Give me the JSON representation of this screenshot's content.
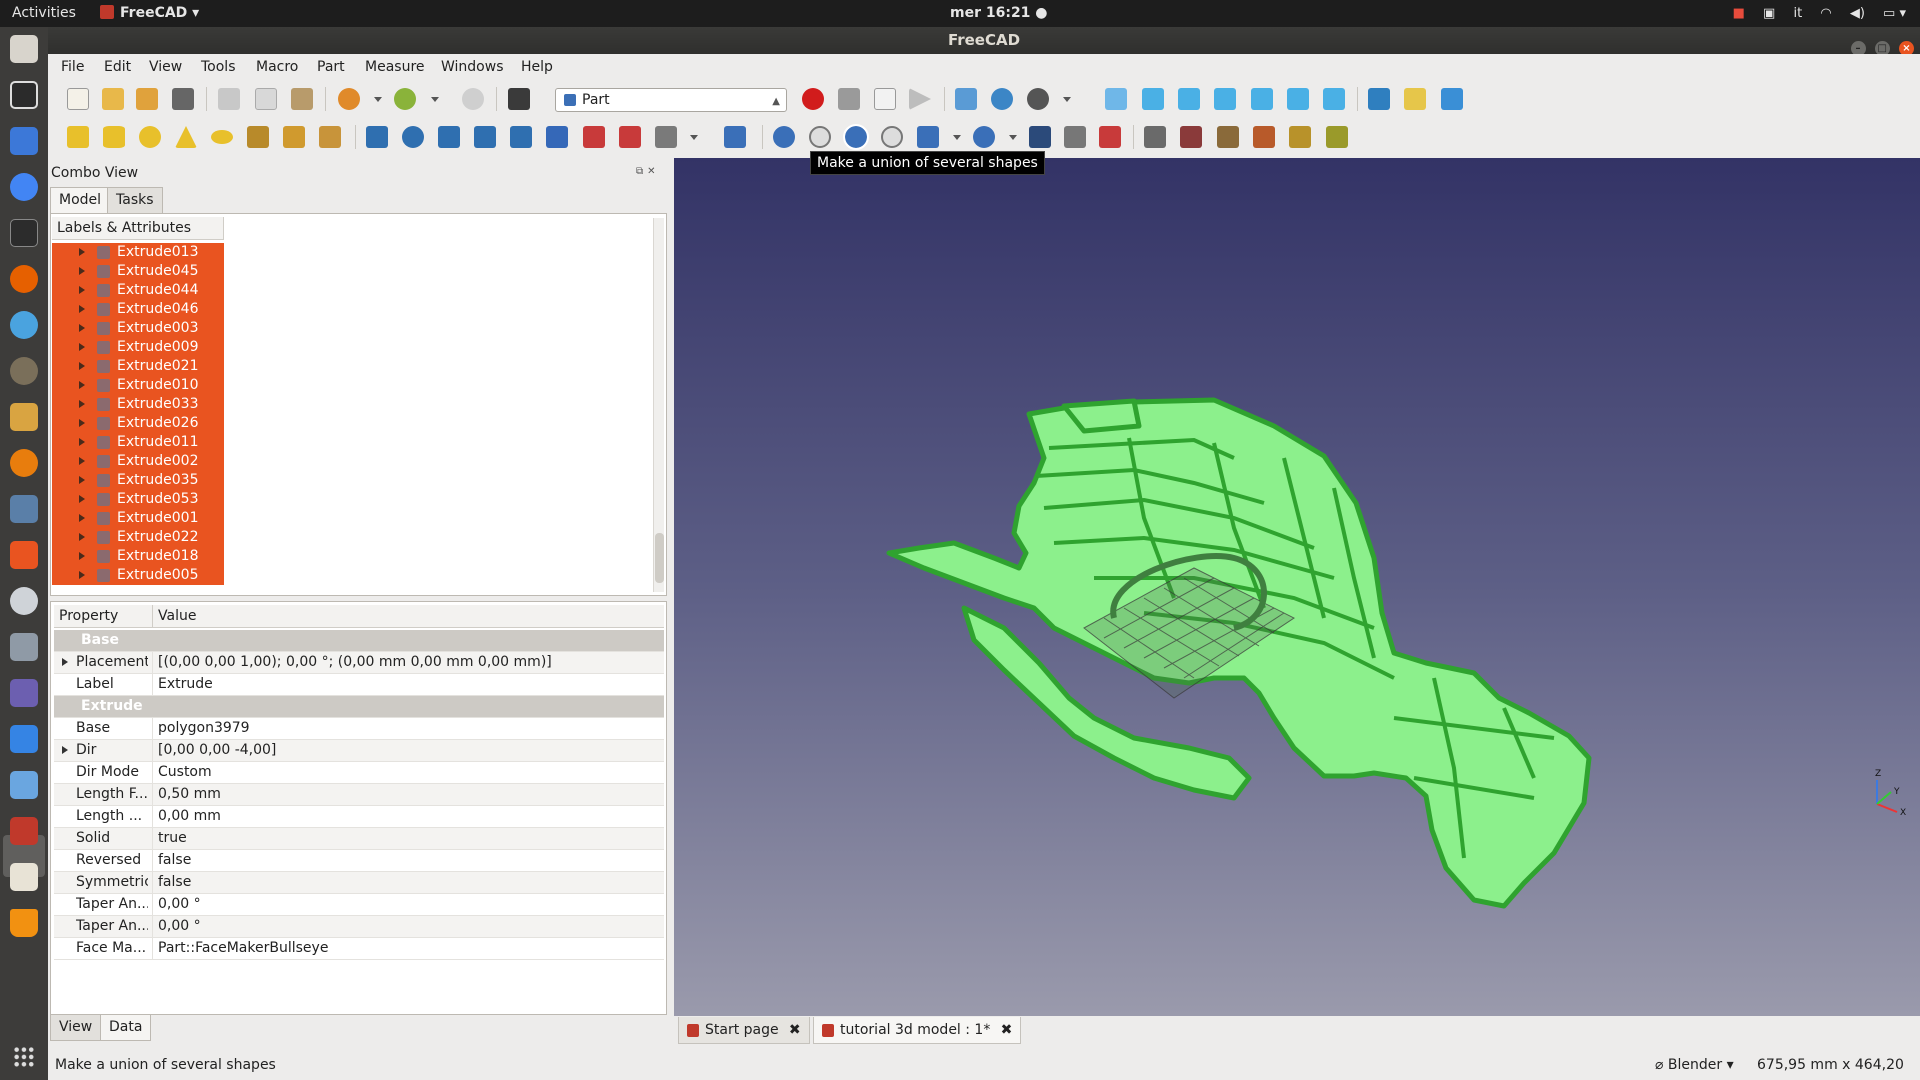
{
  "topbar": {
    "activities": "Activities",
    "app_name": "FreeCAD",
    "clock": "mer 16:21",
    "keyboard_layout": "it"
  },
  "window": {
    "title": "FreeCAD"
  },
  "menu": [
    "File",
    "Edit",
    "View",
    "Tools",
    "Macro",
    "Part",
    "Measure",
    "Windows",
    "Help"
  ],
  "workbench": {
    "selected": "Part"
  },
  "tooltip": "Make a union of several shapes",
  "combo_view": {
    "title": "Combo View",
    "tabs": [
      "Model",
      "Tasks"
    ],
    "tree_header": "Labels & Attributes",
    "tree_items": [
      "Extrude013",
      "Extrude045",
      "Extrude044",
      "Extrude046",
      "Extrude003",
      "Extrude009",
      "Extrude021",
      "Extrude010",
      "Extrude033",
      "Extrude026",
      "Extrude011",
      "Extrude002",
      "Extrude035",
      "Extrude053",
      "Extrude001",
      "Extrude022",
      "Extrude018",
      "Extrude005"
    ]
  },
  "properties": {
    "header_property": "Property",
    "header_value": "Value",
    "rows": [
      {
        "group": "Base"
      },
      {
        "name": "Placement",
        "value": "[(0,00 0,00 1,00); 0,00 °; (0,00 mm  0,00 mm  0,00 mm)]",
        "expandable": true
      },
      {
        "name": "Label",
        "value": "Extrude"
      },
      {
        "group": "Extrude"
      },
      {
        "name": "Base",
        "value": "polygon3979"
      },
      {
        "name": "Dir",
        "value": "[0,00 0,00 -4,00]",
        "expandable": true
      },
      {
        "name": "Dir Mode",
        "value": "Custom"
      },
      {
        "name": "Length F...",
        "value": "0,50 mm"
      },
      {
        "name": "Length ...",
        "value": "0,00 mm"
      },
      {
        "name": "Solid",
        "value": "true"
      },
      {
        "name": "Reversed",
        "value": "false"
      },
      {
        "name": "Symmetric",
        "value": "false"
      },
      {
        "name": "Taper An...",
        "value": "0,00 °"
      },
      {
        "name": "Taper An...",
        "value": "0,00 °"
      },
      {
        "name": "Face Ma...",
        "value": "Part::FaceMakerBullseye"
      }
    ],
    "bottom_tabs": [
      "View",
      "Data"
    ]
  },
  "documents": {
    "tabs": [
      {
        "label": "Start page",
        "active": false
      },
      {
        "label": "tutorial 3d model : 1*",
        "active": true
      }
    ]
  },
  "statusbar": {
    "message": "Make a union of several shapes",
    "nav_style": "Blender",
    "dimensions": "675,95 mm x 464,20 mm"
  },
  "axis_labels": {
    "z": "Z",
    "y": "Y",
    "x": "X"
  },
  "colors": {
    "selection": "#e95420",
    "shape_fill": "#8cf08c",
    "shape_edge": "#2fa32f"
  }
}
